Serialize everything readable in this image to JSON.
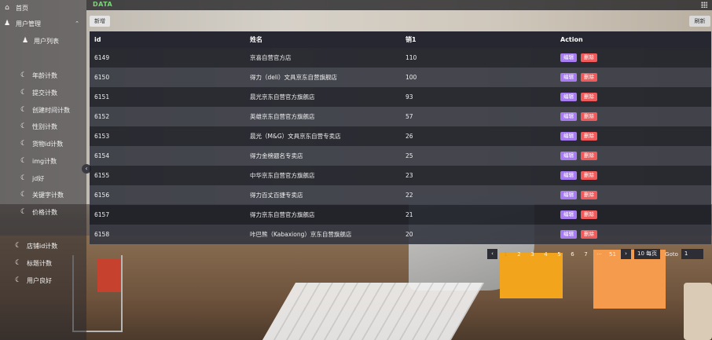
{
  "brand": "DATA",
  "sidebar": {
    "items": [
      {
        "label": "首页",
        "icon": "home-icon",
        "glyph": "⌂"
      },
      {
        "label": "用户管理",
        "icon": "users-group-icon",
        "glyph": "♟"
      },
      {
        "label": "用户列表",
        "icon": "user-list-icon",
        "glyph": "♟"
      },
      {
        "label": "年龄计数",
        "icon": "moon-icon",
        "glyph": "☾"
      },
      {
        "label": "提交计数",
        "icon": "moon-icon",
        "glyph": "☾"
      },
      {
        "label": "创建时间计数",
        "icon": "moon-icon",
        "glyph": "☾"
      },
      {
        "label": "性别计数",
        "icon": "moon-icon",
        "glyph": "☾"
      },
      {
        "label": "货物id计数",
        "icon": "moon-icon",
        "glyph": "☾"
      },
      {
        "label": "img计数",
        "icon": "moon-icon",
        "glyph": "☾"
      },
      {
        "label": "jd好",
        "icon": "moon-icon",
        "glyph": "☾"
      },
      {
        "label": "关键字计数",
        "icon": "moon-icon",
        "glyph": "☾"
      },
      {
        "label": "价格计数",
        "icon": "moon-icon",
        "glyph": "☾"
      },
      {
        "label": "店铺id计数",
        "icon": "moon-icon",
        "glyph": "☾"
      },
      {
        "label": "标题计数",
        "icon": "moon-icon",
        "glyph": "☾"
      },
      {
        "label": "用户良好",
        "icon": "moon-icon",
        "glyph": "☾"
      }
    ]
  },
  "toolbar": {
    "add_label": "新增",
    "refresh_label": "刷新"
  },
  "table": {
    "headers": {
      "id": "id",
      "name": "姓名",
      "sales": "销1",
      "action": "Action"
    },
    "edit_label": "编辑",
    "delete_label": "删除",
    "rows": [
      {
        "id": "6149",
        "name": "京喜自营官方店",
        "sales": "110"
      },
      {
        "id": "6150",
        "name": "得力（deli）文具京东自营旗舰店",
        "sales": "100"
      },
      {
        "id": "6151",
        "name": "晨光京东自营官方旗舰店",
        "sales": "93"
      },
      {
        "id": "6152",
        "name": "英雄京东自营官方旗舰店",
        "sales": "57"
      },
      {
        "id": "6153",
        "name": "晨光（M&G）文具京东自营专卖店",
        "sales": "26"
      },
      {
        "id": "6154",
        "name": "得力金榜题名专卖店",
        "sales": "25"
      },
      {
        "id": "6155",
        "name": "中华京东自营官方旗舰店",
        "sales": "23"
      },
      {
        "id": "6156",
        "name": "得力百丈百捷专卖店",
        "sales": "22"
      },
      {
        "id": "6157",
        "name": "得力京东自营官方旗舰店",
        "sales": "21"
      },
      {
        "id": "6158",
        "name": "咔巴熊（Kabaxiong）京东自营旗舰店",
        "sales": "20"
      }
    ]
  },
  "pagination": {
    "prev": "‹",
    "pages": [
      "1",
      "2",
      "3",
      "4",
      "5",
      "6",
      "7",
      "···",
      "51"
    ],
    "current": "1",
    "next": "›",
    "page_size": "10 每页",
    "goto_label": "Goto",
    "goto_value": "1"
  }
}
